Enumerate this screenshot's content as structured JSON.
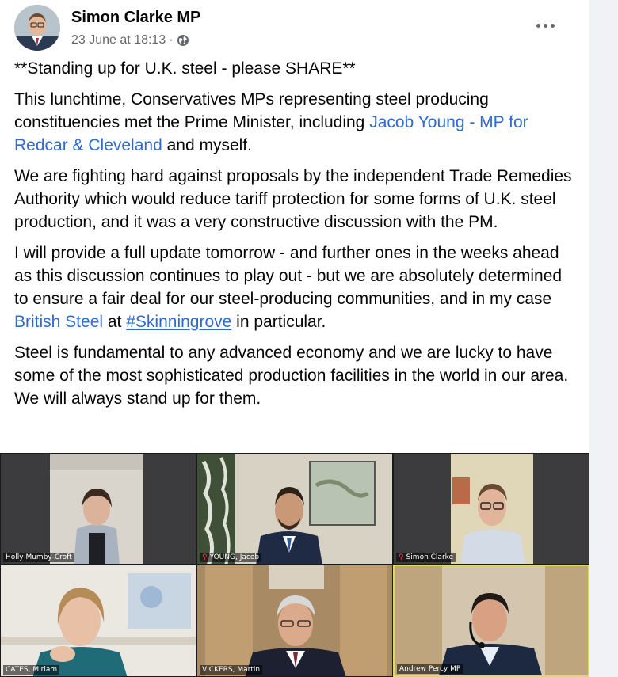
{
  "post": {
    "author": "Simon Clarke MP",
    "timestamp": "23 June at 18:13",
    "separator": "·",
    "audience_icon": "globe-icon",
    "more_icon": "ellipsis-icon"
  },
  "content": {
    "p1": "**Standing up for U.K. steel - please SHARE**",
    "p2_a": "This lunchtime, Conservatives MPs representing steel producing constituencies met the Prime Minister, including ",
    "p2_link": "Jacob Young - MP for Redcar & Cleveland",
    "p2_b": " and myself.",
    "p3": "We are fighting hard against proposals by the independent Trade Remedies Authority which would reduce tariff protection for some forms of U.K. steel production, and it was a very constructive discussion with the PM.",
    "p4_a": "I will provide a full update tomorrow - and further ones in the weeks ahead as this discussion continues to play out - but we are absolutely determined to ensure a fair deal for our steel-producing communities, and in my case ",
    "p4_link": "British Steel",
    "p4_b": " at ",
    "p4_hashtag": "#Skinningrove",
    "p4_c": " in particular.",
    "p5": "Steel is fundamental to any advanced economy and we are lucky to have some of the most sophisticated production facilities in the world in our area.  We will always stand up for them."
  },
  "media": {
    "participants": [
      {
        "name": "Holly Mumby-Croft",
        "muted": false
      },
      {
        "name": "YOUNG, Jacob",
        "muted": true
      },
      {
        "name": "Simon Clarke",
        "muted": true
      },
      {
        "name": "CATES, Miriam",
        "muted": false
      },
      {
        "name": "VICKERS, Martin",
        "muted": false
      },
      {
        "name": "Andrew Percy MP",
        "muted": false
      }
    ],
    "mute_icon": "muted-mic-icon"
  },
  "colors": {
    "link": "#2d6bd2",
    "meta": "#65676b",
    "active_speaker_border": "#d8e04a"
  }
}
